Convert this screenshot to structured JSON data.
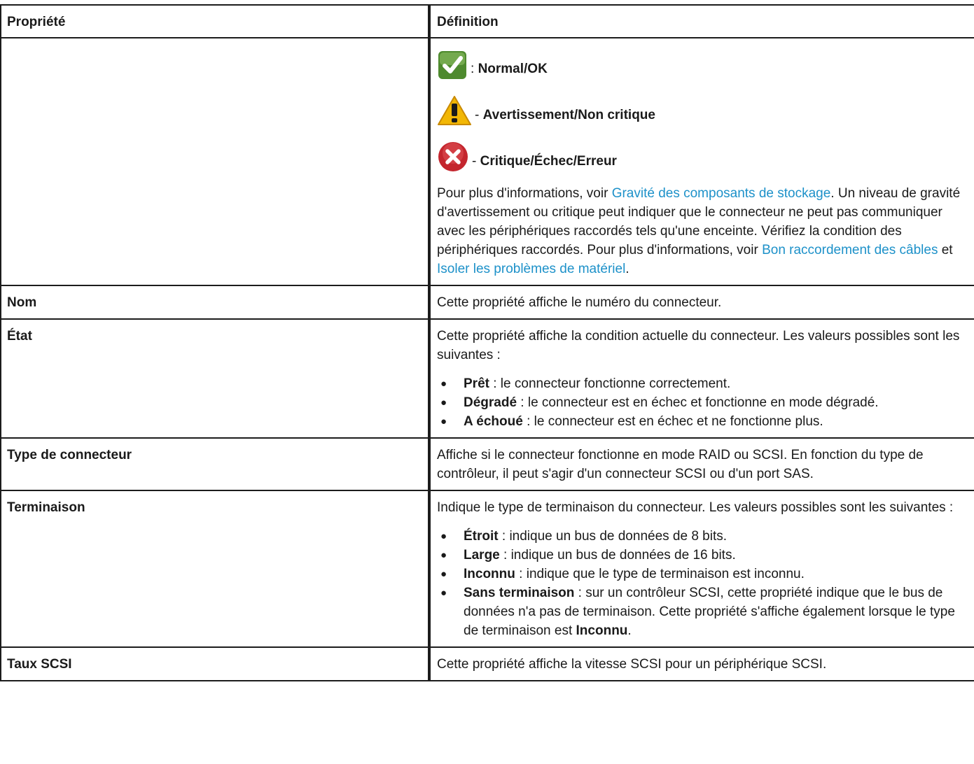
{
  "table": {
    "headers": [
      "Propriété",
      "Définition"
    ],
    "status_row": {
      "legend": [
        {
          "icon": "check-icon",
          "sep": ": ",
          "label": "Normal/OK"
        },
        {
          "icon": "warning-icon",
          "sep": "- ",
          "label": "Avertissement/Non critique"
        },
        {
          "icon": "error-icon",
          "sep": "- ",
          "label": "Critique/Échec/Erreur"
        }
      ],
      "p1_before": "Pour plus d'informations, voir ",
      "link1": "Gravité des composants de stockage",
      "p1_mid": ". Un niveau de gravité d'avertissement ou critique peut indiquer que le connecteur ne peut pas communiquer avec les périphériques raccordés tels qu'une enceinte. Vérifiez la condition des périphériques raccordés. Pour plus d'informations, voir ",
      "link2": "Bon raccordement des câbles",
      "p1_and": " et ",
      "link3": "Isoler les problèmes de matériel",
      "p1_end": "."
    },
    "nom": {
      "label": "Nom",
      "text": "Cette propriété affiche le numéro du connecteur."
    },
    "etat": {
      "label": "État",
      "intro": "Cette propriété affiche la condition actuelle du connecteur. Les valeurs possibles sont les suivantes :",
      "items": [
        {
          "term": "Prêt",
          "desc": " : le connecteur fonctionne correctement."
        },
        {
          "term": "Dégradé",
          "desc": " : le connecteur est en échec et fonctionne en mode dégradé."
        },
        {
          "term": "A échoué",
          "desc": " : le connecteur est en échec et ne fonctionne plus."
        }
      ]
    },
    "type": {
      "label": "Type de connecteur",
      "text": "Affiche si le connecteur fonctionne en mode RAID ou SCSI. En fonction du type de contrôleur, il peut s'agir d'un connecteur SCSI ou d'un port SAS."
    },
    "term": {
      "label": "Terminaison",
      "intro": "Indique le type de terminaison du connecteur. Les valeurs possibles sont les suivantes :",
      "items": [
        {
          "term": "Étroit",
          "desc": " : indique un bus de données de 8 bits."
        },
        {
          "term": "Large",
          "desc": " : indique un bus de données de 16 bits."
        },
        {
          "term": "Inconnu",
          "desc": " : indique que le type de terminaison est inconnu."
        }
      ],
      "last_term": "Sans terminaison",
      "last_desc": " : sur un contrôleur SCSI, cette propriété indique que le bus de données n'a pas de terminaison. Cette propriété s'affiche également lorsque le type de terminaison est ",
      "last_bold": "Inconnu",
      "last_end": "."
    },
    "taux": {
      "label": "Taux SCSI",
      "text": "Cette propriété affiche la vitesse SCSI pour un périphérique SCSI."
    },
    "bullet": "●",
    "colors": {
      "link": "#1d91c9",
      "border": "#1c1c1c",
      "ok": "#4e8a2e",
      "warning": "#f2b705",
      "error": "#c4262e"
    }
  }
}
